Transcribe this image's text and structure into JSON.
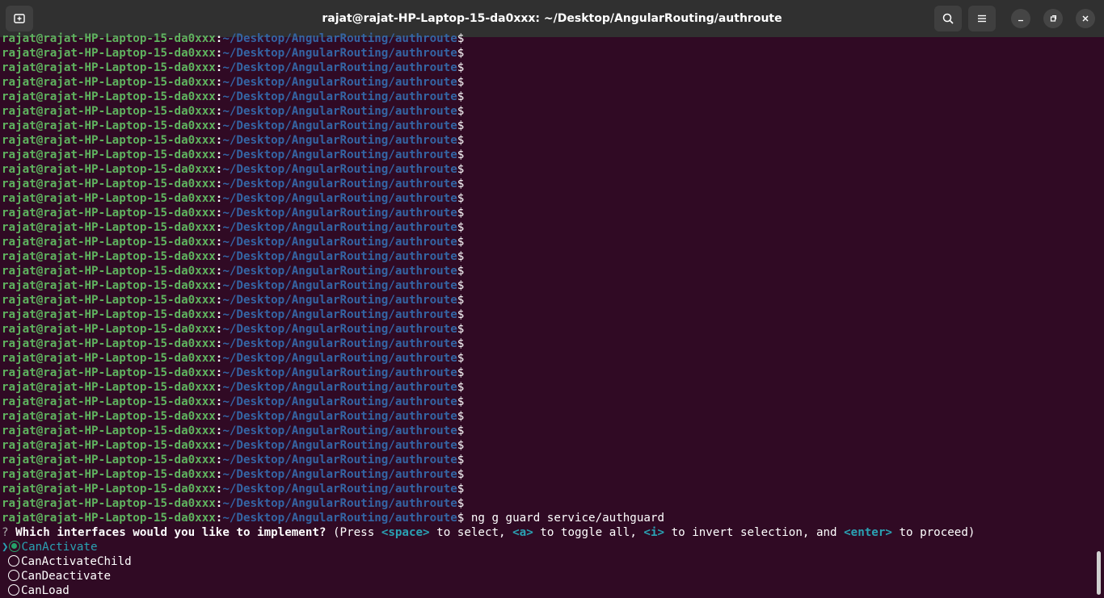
{
  "window": {
    "title": "rajat@rajat-HP-Laptop-15-da0xxx: ~/Desktop/AngularRouting/authroute",
    "icons": {
      "new_tab": "new-tab-icon",
      "search": "search-icon",
      "menu": "hamburger-menu-icon",
      "minimize": "minimize-icon",
      "maximize": "maximize-icon",
      "close": "close-icon"
    }
  },
  "terminal": {
    "prompt_user": "rajat@rajat-HP-Laptop-15-da0xxx",
    "prompt_sep": ":",
    "prompt_path": "~/Desktop/AngularRouting/authroute",
    "prompt_end": "$",
    "empty_prompt_count": 33,
    "command": " ng g guard service/authguard",
    "question": {
      "mark": "?",
      "text": " Which interfaces would you like to implement?",
      "hint_open": " (Press ",
      "key_space": "<space>",
      "hint_1": " to select, ",
      "key_a": "<a>",
      "hint_2": " to toggle all, ",
      "key_i": "<i>",
      "hint_3": " to invert selection, and ",
      "key_enter": "<enter>",
      "hint_4": " to proceed)"
    },
    "options": [
      {
        "label": "CanActivate",
        "selected": true,
        "active": true
      },
      {
        "label": "CanActivateChild",
        "selected": false,
        "active": false
      },
      {
        "label": "CanDeactivate",
        "selected": false,
        "active": false
      },
      {
        "label": "CanLoad",
        "selected": false,
        "active": false
      }
    ],
    "pointer": "❯",
    "colors": {
      "background": "#300a24",
      "user": "#5fb35f",
      "path": "#3465a4",
      "highlight": "#2aa1b3",
      "selected_radio": "#26a269"
    }
  }
}
